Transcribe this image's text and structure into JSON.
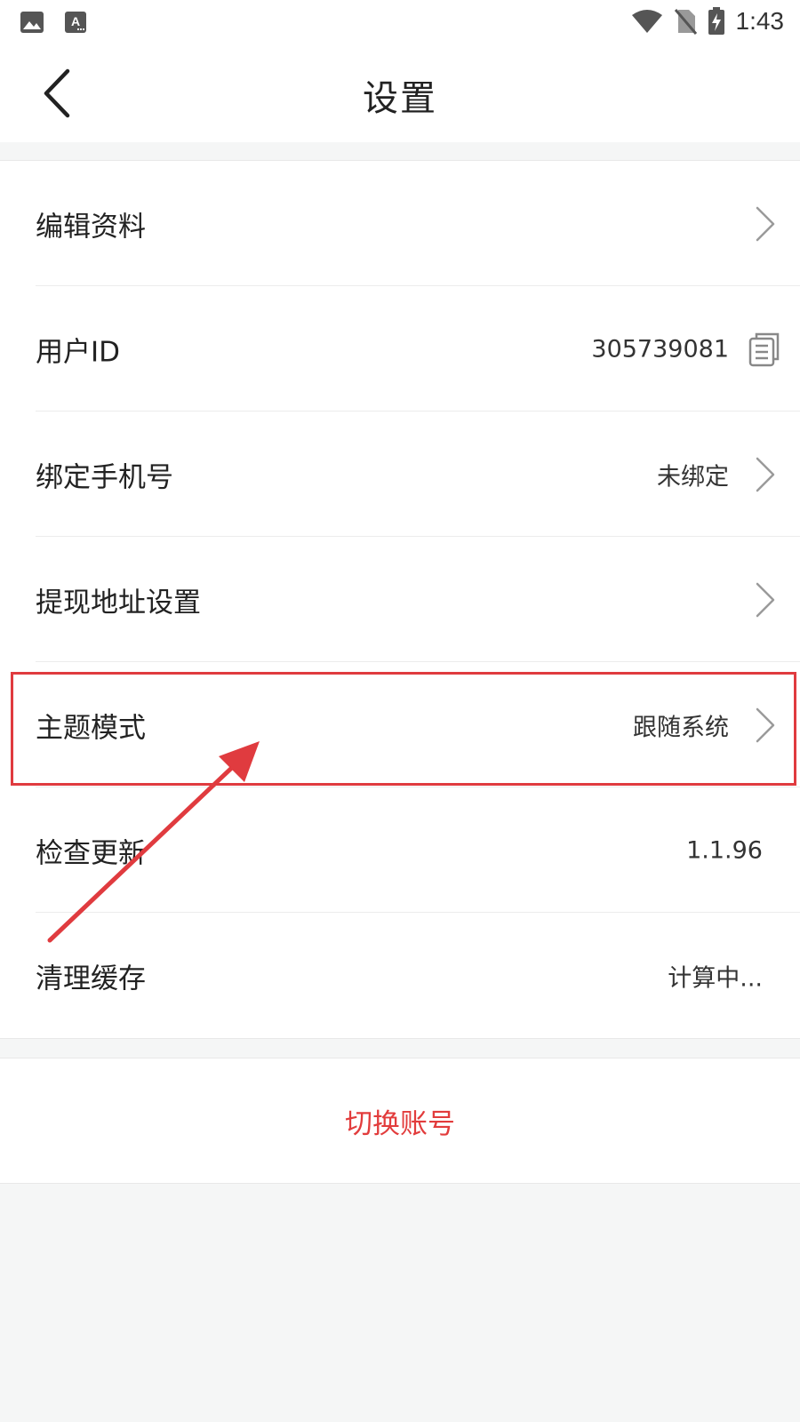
{
  "status_bar": {
    "time": "1:43",
    "left_icons": [
      "gallery-icon",
      "font-app-icon"
    ],
    "right_icons": [
      "wifi-icon",
      "no-sim-icon",
      "battery-charging-icon"
    ]
  },
  "header": {
    "title": "设置",
    "back_icon": "chevron-left-icon"
  },
  "settings": {
    "items": [
      {
        "label": "编辑资料",
        "value": "",
        "icon": "chevron-right-icon"
      },
      {
        "label": "用户ID",
        "value": "305739081",
        "icon": "copy-icon"
      },
      {
        "label": "绑定手机号",
        "value": "未绑定",
        "icon": "chevron-right-icon"
      },
      {
        "label": "提现地址设置",
        "value": "",
        "icon": "chevron-right-icon"
      },
      {
        "label": "主题模式",
        "value": "跟随系统",
        "icon": "chevron-right-icon"
      },
      {
        "label": "检查更新",
        "value": "1.1.96",
        "icon": ""
      },
      {
        "label": "清理缓存",
        "value": "计算中...",
        "icon": ""
      }
    ]
  },
  "actions": {
    "switch_account": "切换账号"
  },
  "colors": {
    "accent": "#e23c3c",
    "annotation": "#e03b3f",
    "background": "#f5f6f6",
    "card": "#ffffff",
    "chevron": "#9a9a9a"
  }
}
